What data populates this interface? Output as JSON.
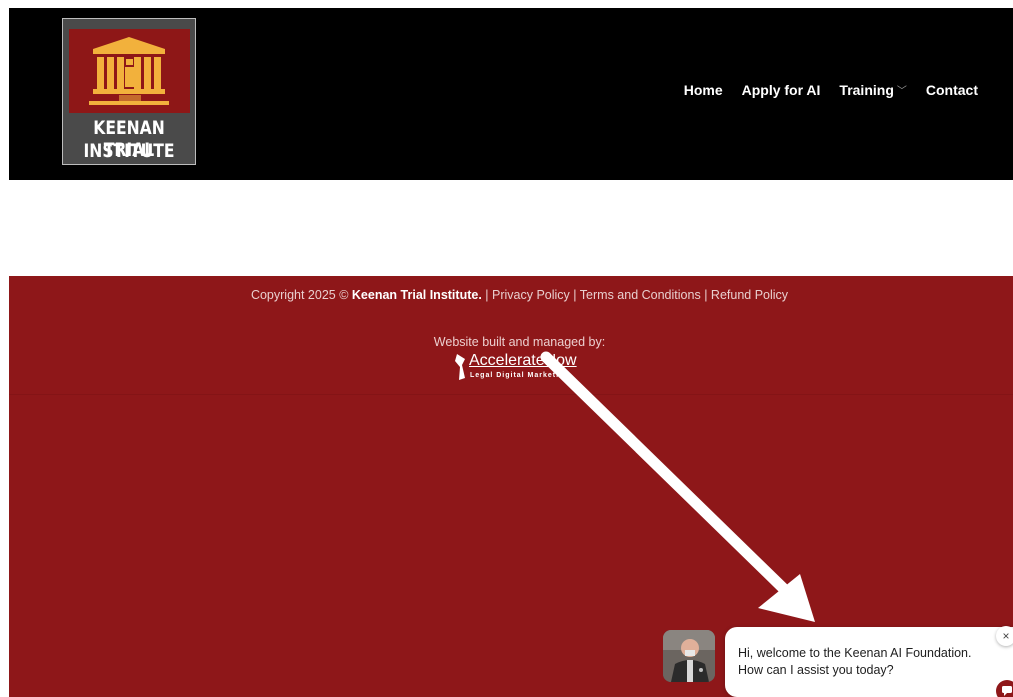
{
  "header": {
    "logo": {
      "line1": "KEENAN TRIAL",
      "line2": "INSTITUTE",
      "icon": "courthouse-icon"
    },
    "nav": {
      "home": "Home",
      "apply": "Apply for AI",
      "training": "Training",
      "training_icon": "chevron-down-icon",
      "contact": "Contact"
    }
  },
  "footer": {
    "copyright_prefix": "Copyright 2025 ©",
    "company": "Keenan Trial Institute.",
    "privacy": "Privacy Policy",
    "terms": "Terms and Conditions",
    "refund": "Refund Policy",
    "separator": "|",
    "built_by": "Website built and managed by:",
    "accelerate_name": "AccelerateNow",
    "accelerate_sub": "Legal Digital Marketing"
  },
  "chat": {
    "line1": "Hi, welcome to the Keenan AI Foundation.",
    "line2": "How can I assist you today?",
    "close": "×",
    "launcher_icon": "chat-bubble-icon"
  },
  "colors": {
    "header_bg": "#000000",
    "footer_bg": "#8e1719",
    "logo_red": "#8e1717",
    "logo_gold": "#f2b13c",
    "arrow": "#ffffff"
  }
}
